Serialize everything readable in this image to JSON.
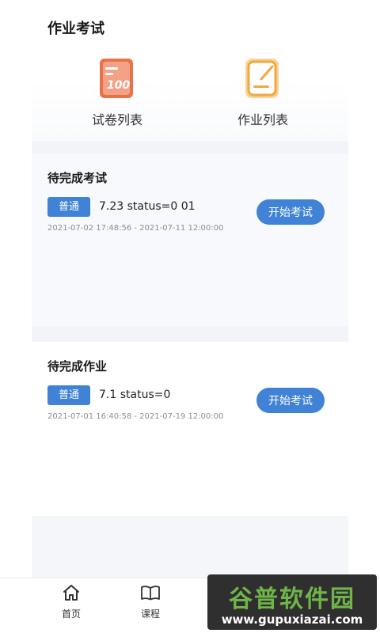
{
  "header": {
    "title": "作业考试"
  },
  "quick_actions": [
    {
      "label": "试卷列表",
      "icon": "exam-paper-icon",
      "color": "#e8734a"
    },
    {
      "label": "作业列表",
      "icon": "homework-edit-icon",
      "color": "#f0a940"
    }
  ],
  "pending_exam": {
    "title": "待完成考试",
    "tag": "普通",
    "name": "7.23 status=0 01",
    "time": "2021-07-02 17:48:56 - 2021-07-11 12:00:00",
    "button": "开始考试"
  },
  "pending_homework": {
    "title": "待完成作业",
    "tag": "普通",
    "name": "7.1 status=0",
    "time": "2021-07-01 16:40:58 - 2021-07-19 12:00:00",
    "button": "开始考试"
  },
  "bottom_nav": [
    {
      "label": "首页",
      "icon": "home-icon"
    },
    {
      "label": "课程",
      "icon": "book-icon"
    }
  ],
  "watermark": {
    "top": "谷普软件园",
    "bottom": "www.gupuxiazai.com"
  },
  "colors": {
    "accent": "#3f82d6"
  }
}
